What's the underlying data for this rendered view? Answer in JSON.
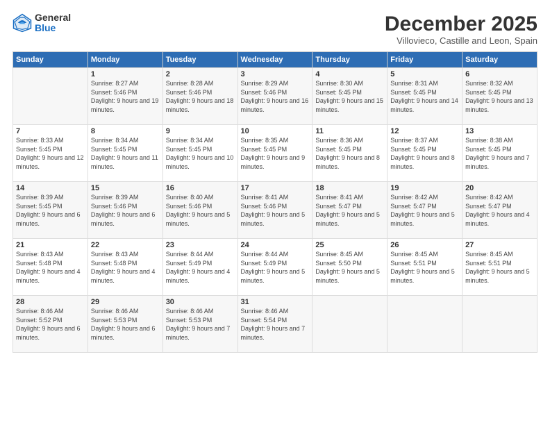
{
  "header": {
    "logo_general": "General",
    "logo_blue": "Blue",
    "month_title": "December 2025",
    "location": "Villovieco, Castille and Leon, Spain"
  },
  "weekdays": [
    "Sunday",
    "Monday",
    "Tuesday",
    "Wednesday",
    "Thursday",
    "Friday",
    "Saturday"
  ],
  "weeks": [
    [
      {
        "num": "",
        "sunrise": "",
        "sunset": "",
        "daylight": ""
      },
      {
        "num": "1",
        "sunrise": "Sunrise: 8:27 AM",
        "sunset": "Sunset: 5:46 PM",
        "daylight": "Daylight: 9 hours and 19 minutes."
      },
      {
        "num": "2",
        "sunrise": "Sunrise: 8:28 AM",
        "sunset": "Sunset: 5:46 PM",
        "daylight": "Daylight: 9 hours and 18 minutes."
      },
      {
        "num": "3",
        "sunrise": "Sunrise: 8:29 AM",
        "sunset": "Sunset: 5:46 PM",
        "daylight": "Daylight: 9 hours and 16 minutes."
      },
      {
        "num": "4",
        "sunrise": "Sunrise: 8:30 AM",
        "sunset": "Sunset: 5:45 PM",
        "daylight": "Daylight: 9 hours and 15 minutes."
      },
      {
        "num": "5",
        "sunrise": "Sunrise: 8:31 AM",
        "sunset": "Sunset: 5:45 PM",
        "daylight": "Daylight: 9 hours and 14 minutes."
      },
      {
        "num": "6",
        "sunrise": "Sunrise: 8:32 AM",
        "sunset": "Sunset: 5:45 PM",
        "daylight": "Daylight: 9 hours and 13 minutes."
      }
    ],
    [
      {
        "num": "7",
        "sunrise": "Sunrise: 8:33 AM",
        "sunset": "Sunset: 5:45 PM",
        "daylight": "Daylight: 9 hours and 12 minutes."
      },
      {
        "num": "8",
        "sunrise": "Sunrise: 8:34 AM",
        "sunset": "Sunset: 5:45 PM",
        "daylight": "Daylight: 9 hours and 11 minutes."
      },
      {
        "num": "9",
        "sunrise": "Sunrise: 8:34 AM",
        "sunset": "Sunset: 5:45 PM",
        "daylight": "Daylight: 9 hours and 10 minutes."
      },
      {
        "num": "10",
        "sunrise": "Sunrise: 8:35 AM",
        "sunset": "Sunset: 5:45 PM",
        "daylight": "Daylight: 9 hours and 9 minutes."
      },
      {
        "num": "11",
        "sunrise": "Sunrise: 8:36 AM",
        "sunset": "Sunset: 5:45 PM",
        "daylight": "Daylight: 9 hours and 8 minutes."
      },
      {
        "num": "12",
        "sunrise": "Sunrise: 8:37 AM",
        "sunset": "Sunset: 5:45 PM",
        "daylight": "Daylight: 9 hours and 8 minutes."
      },
      {
        "num": "13",
        "sunrise": "Sunrise: 8:38 AM",
        "sunset": "Sunset: 5:45 PM",
        "daylight": "Daylight: 9 hours and 7 minutes."
      }
    ],
    [
      {
        "num": "14",
        "sunrise": "Sunrise: 8:39 AM",
        "sunset": "Sunset: 5:45 PM",
        "daylight": "Daylight: 9 hours and 6 minutes."
      },
      {
        "num": "15",
        "sunrise": "Sunrise: 8:39 AM",
        "sunset": "Sunset: 5:46 PM",
        "daylight": "Daylight: 9 hours and 6 minutes."
      },
      {
        "num": "16",
        "sunrise": "Sunrise: 8:40 AM",
        "sunset": "Sunset: 5:46 PM",
        "daylight": "Daylight: 9 hours and 5 minutes."
      },
      {
        "num": "17",
        "sunrise": "Sunrise: 8:41 AM",
        "sunset": "Sunset: 5:46 PM",
        "daylight": "Daylight: 9 hours and 5 minutes."
      },
      {
        "num": "18",
        "sunrise": "Sunrise: 8:41 AM",
        "sunset": "Sunset: 5:47 PM",
        "daylight": "Daylight: 9 hours and 5 minutes."
      },
      {
        "num": "19",
        "sunrise": "Sunrise: 8:42 AM",
        "sunset": "Sunset: 5:47 PM",
        "daylight": "Daylight: 9 hours and 5 minutes."
      },
      {
        "num": "20",
        "sunrise": "Sunrise: 8:42 AM",
        "sunset": "Sunset: 5:47 PM",
        "daylight": "Daylight: 9 hours and 4 minutes."
      }
    ],
    [
      {
        "num": "21",
        "sunrise": "Sunrise: 8:43 AM",
        "sunset": "Sunset: 5:48 PM",
        "daylight": "Daylight: 9 hours and 4 minutes."
      },
      {
        "num": "22",
        "sunrise": "Sunrise: 8:43 AM",
        "sunset": "Sunset: 5:48 PM",
        "daylight": "Daylight: 9 hours and 4 minutes."
      },
      {
        "num": "23",
        "sunrise": "Sunrise: 8:44 AM",
        "sunset": "Sunset: 5:49 PM",
        "daylight": "Daylight: 9 hours and 4 minutes."
      },
      {
        "num": "24",
        "sunrise": "Sunrise: 8:44 AM",
        "sunset": "Sunset: 5:49 PM",
        "daylight": "Daylight: 9 hours and 5 minutes."
      },
      {
        "num": "25",
        "sunrise": "Sunrise: 8:45 AM",
        "sunset": "Sunset: 5:50 PM",
        "daylight": "Daylight: 9 hours and 5 minutes."
      },
      {
        "num": "26",
        "sunrise": "Sunrise: 8:45 AM",
        "sunset": "Sunset: 5:51 PM",
        "daylight": "Daylight: 9 hours and 5 minutes."
      },
      {
        "num": "27",
        "sunrise": "Sunrise: 8:45 AM",
        "sunset": "Sunset: 5:51 PM",
        "daylight": "Daylight: 9 hours and 5 minutes."
      }
    ],
    [
      {
        "num": "28",
        "sunrise": "Sunrise: 8:46 AM",
        "sunset": "Sunset: 5:52 PM",
        "daylight": "Daylight: 9 hours and 6 minutes."
      },
      {
        "num": "29",
        "sunrise": "Sunrise: 8:46 AM",
        "sunset": "Sunset: 5:53 PM",
        "daylight": "Daylight: 9 hours and 6 minutes."
      },
      {
        "num": "30",
        "sunrise": "Sunrise: 8:46 AM",
        "sunset": "Sunset: 5:53 PM",
        "daylight": "Daylight: 9 hours and 7 minutes."
      },
      {
        "num": "31",
        "sunrise": "Sunrise: 8:46 AM",
        "sunset": "Sunset: 5:54 PM",
        "daylight": "Daylight: 9 hours and 7 minutes."
      },
      {
        "num": "",
        "sunrise": "",
        "sunset": "",
        "daylight": ""
      },
      {
        "num": "",
        "sunrise": "",
        "sunset": "",
        "daylight": ""
      },
      {
        "num": "",
        "sunrise": "",
        "sunset": "",
        "daylight": ""
      }
    ]
  ]
}
